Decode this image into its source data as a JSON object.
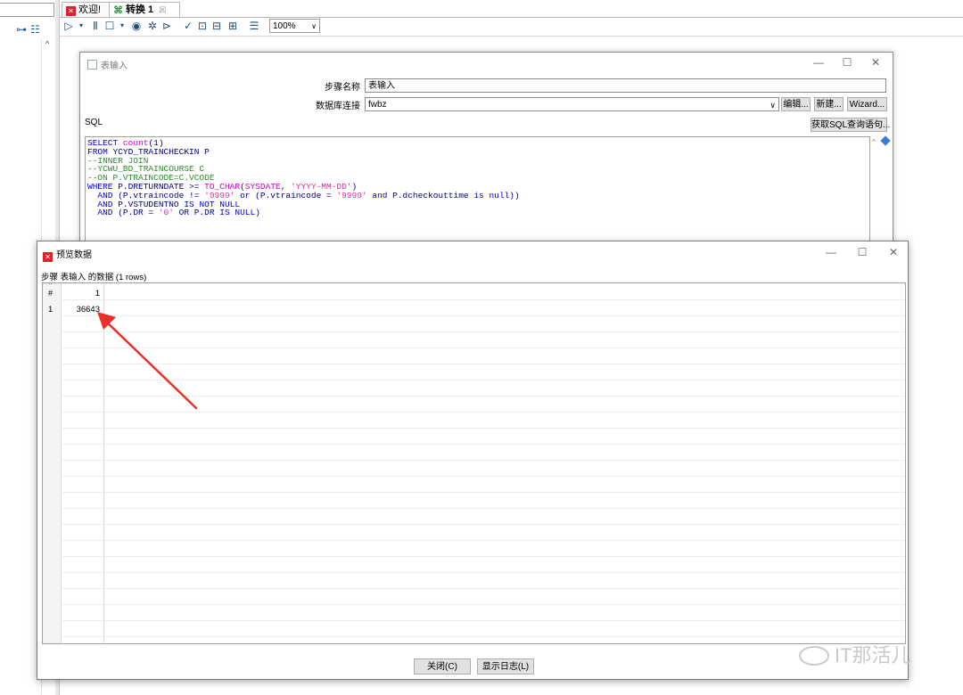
{
  "tabs": [
    {
      "label": "欢迎!"
    },
    {
      "label": "转换 1",
      "close": "☒"
    }
  ],
  "toolbar": {
    "zoom": "100%"
  },
  "table_input": {
    "title": "表输入",
    "step_name_label": "步骤名称",
    "step_name_value": "表输入",
    "connection_label": "数据库连接",
    "connection_value": "fwbz",
    "edit_button": "编辑...",
    "new_button": "新建...",
    "wizard_button": "Wizard...",
    "sql_label": "SQL",
    "get_sql_button": "获取SQL查询语句...",
    "sql_lines": [
      "SELECT count(1)",
      "FROM YCYD_TRAINCHECKIN P",
      "--INNER JOIN",
      "--YCWU_BD_TRAINCOURSE C",
      "--ON P.VTRAINCODE=C.VCODE",
      "WHERE P.DRETURNDATE >= TO_CHAR(SYSDATE, 'YYYY-MM-DD')",
      "  AND (P.vtraincode != '9999' or (P.vtraincode = '9999' and P.dcheckouttime is null))",
      "  AND P.VSTUDENTNO IS NOT NULL",
      "  AND (P.DR = '0' OR P.DR IS NULL)"
    ]
  },
  "preview": {
    "title": "预览数据",
    "caption": "步骤 表输入 的数据 (1 rows)",
    "columns": [
      "#",
      "1"
    ],
    "rows": [
      {
        "num": "1",
        "value": "36643"
      }
    ],
    "close_button": "关闭(C)",
    "log_button": "显示日志(L)"
  },
  "watermark": "IT那活儿",
  "colors": {
    "accent_red": "#d9262c",
    "arrow_red": "#e8302a",
    "sql_keyword": "#0000cc",
    "sql_comment": "#2d8a2d",
    "sql_string": "#cc3399"
  }
}
